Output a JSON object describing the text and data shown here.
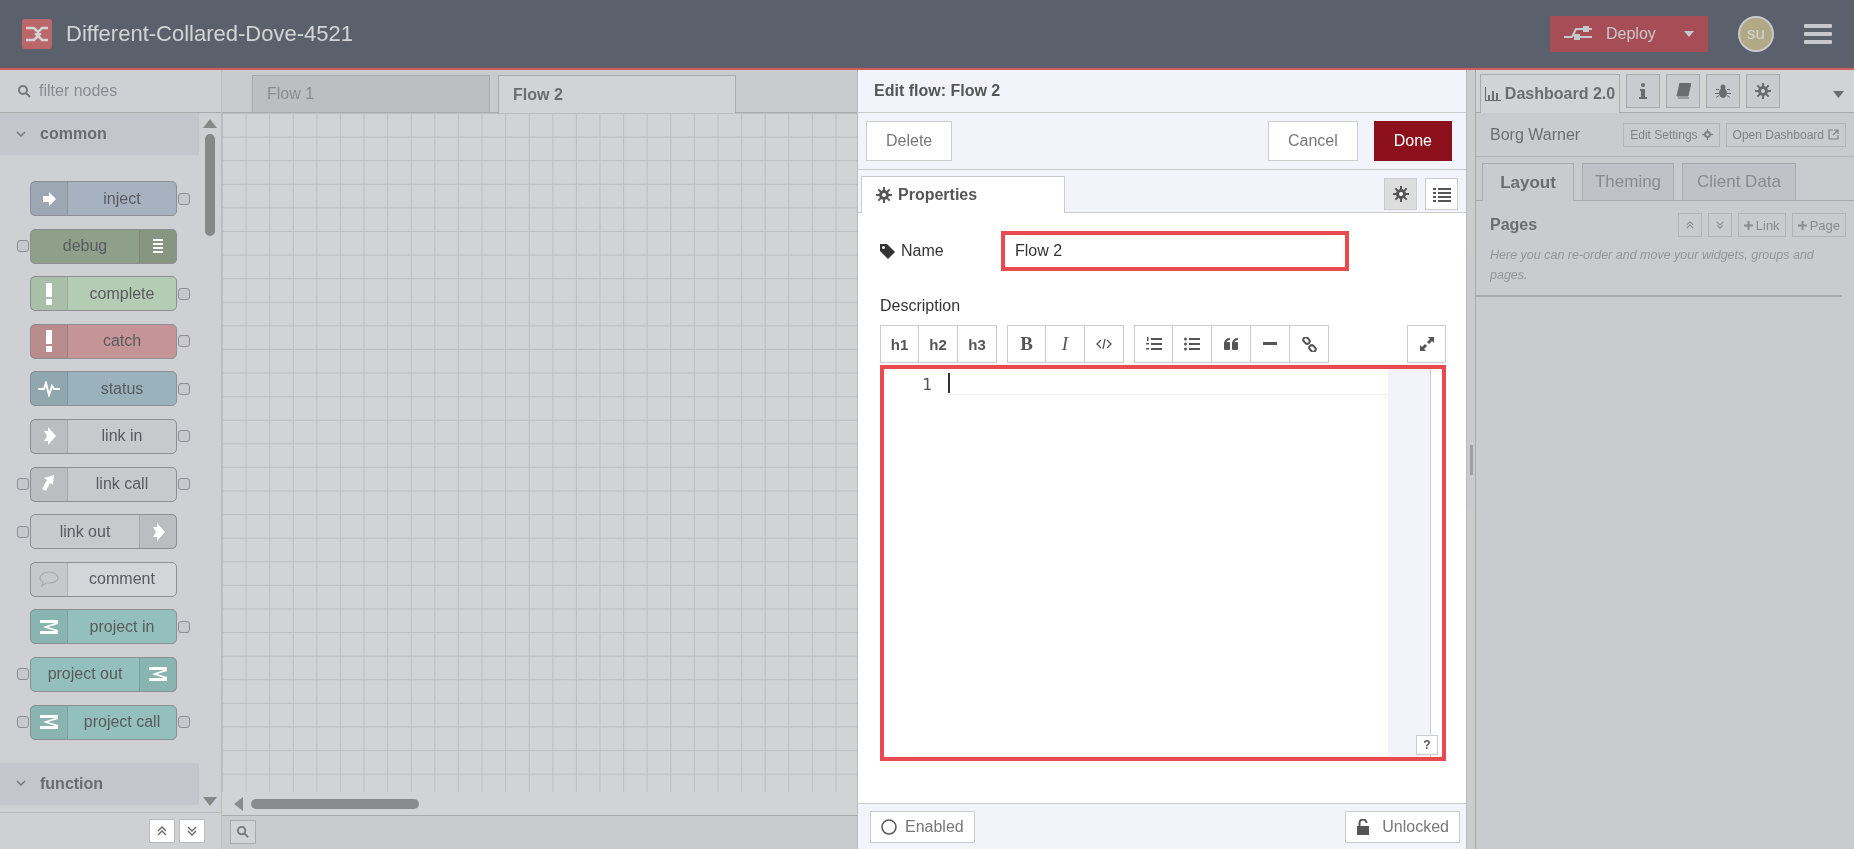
{
  "header": {
    "title": "Different-Collared-Dove-4521",
    "deploy": "Deploy",
    "avatar": "su"
  },
  "palette": {
    "filter_placeholder": "filter nodes",
    "categories": [
      {
        "name": "common",
        "expanded": true,
        "nodes": [
          {
            "label": "inject",
            "color": "#a7b2c0",
            "icon_right": false,
            "input": false,
            "output": true
          },
          {
            "label": "debug",
            "color": "#8fa08a",
            "icon_right": true,
            "input": true,
            "output": false
          },
          {
            "label": "complete",
            "color": "#b4cbb4",
            "icon_right": false,
            "input": false,
            "output": true
          },
          {
            "label": "catch",
            "color": "#c49496",
            "icon_right": false,
            "input": false,
            "output": true
          },
          {
            "label": "status",
            "color": "#9ab2bc",
            "icon_right": false,
            "input": false,
            "output": true
          },
          {
            "label": "link in",
            "color": "#c8c9cd",
            "icon_right": false,
            "input": false,
            "output": true
          },
          {
            "label": "link call",
            "color": "#c8c9cd",
            "icon_right": false,
            "input": true,
            "output": true
          },
          {
            "label": "link out",
            "color": "#c8c9cd",
            "icon_right": true,
            "input": true,
            "output": false
          },
          {
            "label": "comment",
            "color": "#d4d5d9",
            "icon_right": false,
            "input": false,
            "output": false
          },
          {
            "label": "project in",
            "color": "#93c0bc",
            "icon_right": false,
            "input": false,
            "output": true
          },
          {
            "label": "project out",
            "color": "#93c0bc",
            "icon_right": true,
            "input": true,
            "output": false
          },
          {
            "label": "project call",
            "color": "#93c0bc",
            "icon_right": false,
            "input": true,
            "output": true
          }
        ]
      },
      {
        "name": "function",
        "expanded": true
      }
    ]
  },
  "workspace": {
    "tabs": [
      {
        "label": "Flow 1",
        "selected": false
      },
      {
        "label": "Flow 2",
        "selected": true
      }
    ]
  },
  "tray": {
    "title": "Edit flow: Flow 2",
    "delete": "Delete",
    "cancel": "Cancel",
    "done": "Done",
    "tabs": [
      {
        "label": "Properties",
        "selected": true
      }
    ],
    "view_buttons": [
      {
        "kind": "gear",
        "selected": true
      },
      {
        "kind": "list",
        "selected": false
      }
    ],
    "name_label": "Name",
    "name_value": "Flow 2",
    "name_highlighted": true,
    "description_label": "Description",
    "toolbar": [
      [
        {
          "kind": "heading",
          "label": "h1"
        },
        {
          "kind": "heading",
          "label": "h2"
        },
        {
          "kind": "heading",
          "label": "h3"
        }
      ],
      [
        {
          "kind": "bold",
          "label": "B"
        },
        {
          "kind": "italic",
          "label": "I"
        },
        {
          "kind": "code"
        }
      ],
      [
        {
          "kind": "numbered"
        },
        {
          "kind": "bulleted"
        },
        {
          "kind": "quote"
        },
        {
          "kind": "rule"
        },
        {
          "kind": "link"
        }
      ],
      [
        {
          "kind": "expand"
        }
      ]
    ],
    "editor": {
      "line_number": "1",
      "highlighted": true,
      "help": "?"
    },
    "enabled": {
      "label": "Enabled",
      "on": false
    },
    "lock": {
      "label": "Unlocked",
      "locked": false
    }
  },
  "sidebar": {
    "tabs": [
      {
        "kind": "dashboard",
        "label": "Dashboard 2.0",
        "selected": true
      },
      {
        "kind": "info",
        "selected": false
      },
      {
        "kind": "book",
        "selected": false
      },
      {
        "kind": "bug",
        "selected": false
      },
      {
        "kind": "gear",
        "selected": false
      }
    ],
    "dashboard_name": "Borg Warner",
    "edit_settings": "Edit Settings",
    "open_dashboard": "Open Dashboard",
    "subtabs": [
      {
        "label": "Layout",
        "selected": true
      },
      {
        "label": "Theming",
        "selected": false
      },
      {
        "label": "Client Data",
        "selected": false
      }
    ],
    "pages_title": "Pages",
    "link_button": "Link",
    "page_button": "Page",
    "hint": "Here you can re-order and move your widgets, groups and pages."
  }
}
